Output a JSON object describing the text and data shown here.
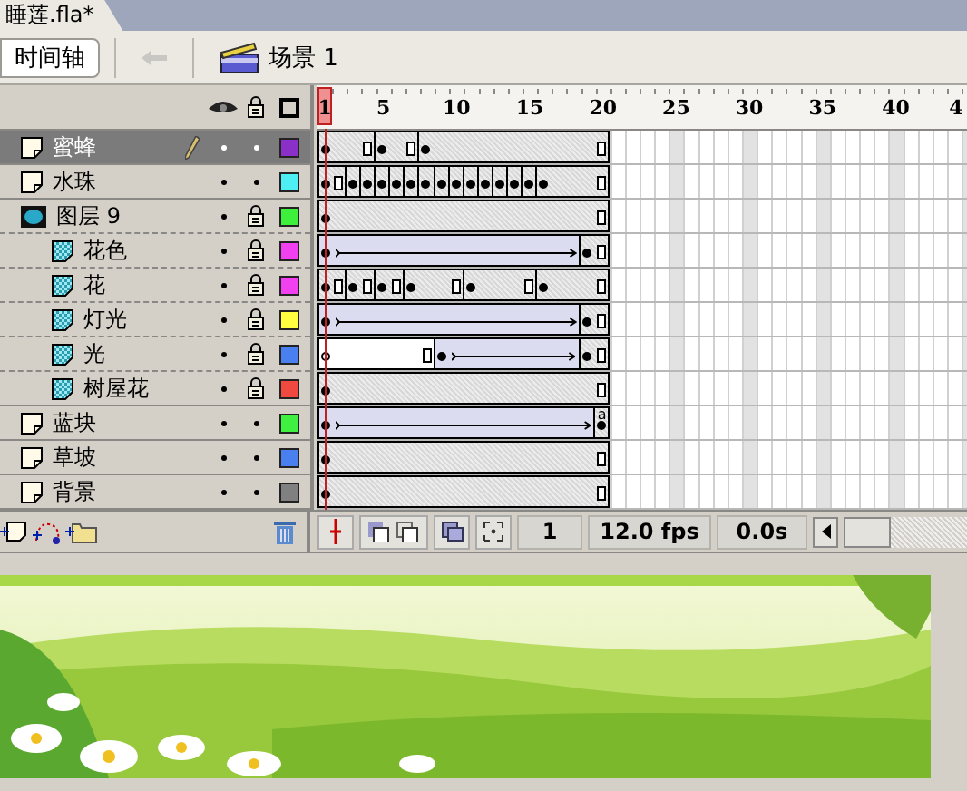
{
  "document_tab": {
    "title": "睡莲.fla*"
  },
  "toolbar": {
    "timeline_button": "时间轴",
    "back_disabled": true,
    "scene": "场景 1"
  },
  "ruler": {
    "labels": [
      {
        "text": "1",
        "current": true
      },
      {
        "text": "5",
        "current": false
      },
      {
        "text": "10",
        "current": false
      },
      {
        "text": "15",
        "current": false
      },
      {
        "text": "20",
        "current": false
      },
      {
        "text": "25",
        "current": false
      },
      {
        "text": "30",
        "current": false
      },
      {
        "text": "35",
        "current": false
      },
      {
        "text": "40",
        "current": false
      },
      {
        "text": "4",
        "current": false
      }
    ]
  },
  "layers": [
    {
      "name": "蜜蜂",
      "kind": "normal",
      "selected": true,
      "editing": true,
      "locked": false,
      "color": "#8b2fc9",
      "cells": [
        {
          "kind": "key"
        },
        {
          "kind": "frame"
        },
        {
          "kind": "frame"
        },
        {
          "kind": "end"
        },
        {
          "kind": "key"
        },
        {
          "kind": "frame"
        },
        {
          "kind": "end"
        },
        {
          "kind": "key"
        },
        {
          "kind": "frame"
        },
        {
          "kind": "frame"
        },
        {
          "kind": "frame"
        },
        {
          "kind": "frame"
        },
        {
          "kind": "frame"
        },
        {
          "kind": "frame"
        },
        {
          "kind": "frame"
        },
        {
          "kind": "frame"
        },
        {
          "kind": "frame"
        },
        {
          "kind": "frame"
        },
        {
          "kind": "frame"
        },
        {
          "kind": "end"
        }
      ]
    },
    {
      "name": "水珠",
      "kind": "normal",
      "selected": false,
      "editing": false,
      "locked": false,
      "color": "#4deef4",
      "cells": [
        {
          "kind": "key"
        },
        {
          "kind": "end"
        },
        {
          "kind": "key"
        },
        {
          "kind": "key"
        },
        {
          "kind": "key"
        },
        {
          "kind": "key"
        },
        {
          "kind": "key"
        },
        {
          "kind": "key"
        },
        {
          "kind": "key"
        },
        {
          "kind": "key"
        },
        {
          "kind": "key"
        },
        {
          "kind": "key"
        },
        {
          "kind": "key"
        },
        {
          "kind": "key"
        },
        {
          "kind": "key"
        },
        {
          "kind": "key"
        },
        {
          "kind": "frame"
        },
        {
          "kind": "frame"
        },
        {
          "kind": "frame"
        },
        {
          "kind": "end"
        }
      ]
    },
    {
      "name": "图层 9",
      "kind": "mask",
      "selected": false,
      "editing": false,
      "locked": true,
      "color": "#3cf03c",
      "cells": [
        {
          "kind": "key"
        },
        {
          "kind": "frame"
        },
        {
          "kind": "frame"
        },
        {
          "kind": "frame"
        },
        {
          "kind": "frame"
        },
        {
          "kind": "frame"
        },
        {
          "kind": "frame"
        },
        {
          "kind": "frame"
        },
        {
          "kind": "frame"
        },
        {
          "kind": "frame"
        },
        {
          "kind": "frame"
        },
        {
          "kind": "frame"
        },
        {
          "kind": "frame"
        },
        {
          "kind": "frame"
        },
        {
          "kind": "frame"
        },
        {
          "kind": "frame"
        },
        {
          "kind": "frame"
        },
        {
          "kind": "frame"
        },
        {
          "kind": "frame"
        },
        {
          "kind": "end"
        }
      ],
      "children": [
        {
          "name": "花色",
          "kind": "masked",
          "selected": false,
          "editing": false,
          "locked": true,
          "color": "#f040f0",
          "cells": [
            {
              "kind": "tween_key"
            },
            {
              "kind": "tween"
            },
            {
              "kind": "tween"
            },
            {
              "kind": "tween"
            },
            {
              "kind": "tween"
            },
            {
              "kind": "tween"
            },
            {
              "kind": "tween"
            },
            {
              "kind": "tween"
            },
            {
              "kind": "tween"
            },
            {
              "kind": "tween"
            },
            {
              "kind": "tween"
            },
            {
              "kind": "tween"
            },
            {
              "kind": "tween"
            },
            {
              "kind": "tween"
            },
            {
              "kind": "tween"
            },
            {
              "kind": "tween"
            },
            {
              "kind": "tween"
            },
            {
              "kind": "tween"
            },
            {
              "kind": "key"
            },
            {
              "kind": "end"
            }
          ]
        },
        {
          "name": "花",
          "kind": "masked",
          "selected": false,
          "editing": false,
          "locked": true,
          "color": "#f040f0",
          "cells": [
            {
              "kind": "key"
            },
            {
              "kind": "end"
            },
            {
              "kind": "key"
            },
            {
              "kind": "end"
            },
            {
              "kind": "key"
            },
            {
              "kind": "end"
            },
            {
              "kind": "key"
            },
            {
              "kind": "frame"
            },
            {
              "kind": "frame"
            },
            {
              "kind": "end"
            },
            {
              "kind": "key"
            },
            {
              "kind": "frame"
            },
            {
              "kind": "frame"
            },
            {
              "kind": "frame"
            },
            {
              "kind": "end"
            },
            {
              "kind": "key"
            },
            {
              "kind": "frame"
            },
            {
              "kind": "frame"
            },
            {
              "kind": "frame"
            },
            {
              "kind": "end"
            }
          ]
        },
        {
          "name": "灯光",
          "kind": "masked",
          "selected": false,
          "editing": false,
          "locked": true,
          "color": "#ffff40",
          "cells": [
            {
              "kind": "tween_key"
            },
            {
              "kind": "tween"
            },
            {
              "kind": "tween"
            },
            {
              "kind": "tween"
            },
            {
              "kind": "tween"
            },
            {
              "kind": "tween"
            },
            {
              "kind": "tween"
            },
            {
              "kind": "tween"
            },
            {
              "kind": "tween"
            },
            {
              "kind": "tween"
            },
            {
              "kind": "tween"
            },
            {
              "kind": "tween"
            },
            {
              "kind": "tween"
            },
            {
              "kind": "tween"
            },
            {
              "kind": "tween"
            },
            {
              "kind": "tween"
            },
            {
              "kind": "tween"
            },
            {
              "kind": "tween"
            },
            {
              "kind": "key"
            },
            {
              "kind": "end"
            }
          ]
        },
        {
          "name": "光",
          "kind": "masked",
          "selected": false,
          "editing": false,
          "locked": true,
          "color": "#4a7ff0",
          "cells": [
            {
              "kind": "blank_key"
            },
            {
              "kind": "frame"
            },
            {
              "kind": "frame"
            },
            {
              "kind": "frame"
            },
            {
              "kind": "frame"
            },
            {
              "kind": "frame"
            },
            {
              "kind": "frame"
            },
            {
              "kind": "end"
            },
            {
              "kind": "tween_key"
            },
            {
              "kind": "tween"
            },
            {
              "kind": "tween"
            },
            {
              "kind": "tween"
            },
            {
              "kind": "tween"
            },
            {
              "kind": "tween"
            },
            {
              "kind": "tween"
            },
            {
              "kind": "tween"
            },
            {
              "kind": "tween"
            },
            {
              "kind": "tween"
            },
            {
              "kind": "key"
            },
            {
              "kind": "end"
            }
          ]
        },
        {
          "name": "树屋花",
          "kind": "masked",
          "selected": false,
          "editing": false,
          "locked": true,
          "color": "#f04a40",
          "cells": [
            {
              "kind": "key"
            },
            {
              "kind": "frame"
            },
            {
              "kind": "frame"
            },
            {
              "kind": "frame"
            },
            {
              "kind": "frame"
            },
            {
              "kind": "frame"
            },
            {
              "kind": "frame"
            },
            {
              "kind": "frame"
            },
            {
              "kind": "frame"
            },
            {
              "kind": "frame"
            },
            {
              "kind": "frame"
            },
            {
              "kind": "frame"
            },
            {
              "kind": "frame"
            },
            {
              "kind": "frame"
            },
            {
              "kind": "frame"
            },
            {
              "kind": "frame"
            },
            {
              "kind": "frame"
            },
            {
              "kind": "frame"
            },
            {
              "kind": "frame"
            },
            {
              "kind": "end"
            }
          ]
        }
      ]
    },
    {
      "name": "蓝块",
      "kind": "normal",
      "selected": false,
      "editing": false,
      "locked": false,
      "color": "#40f040",
      "cells": [
        {
          "kind": "tween_key"
        },
        {
          "kind": "tween"
        },
        {
          "kind": "tween"
        },
        {
          "kind": "tween"
        },
        {
          "kind": "tween"
        },
        {
          "kind": "tween"
        },
        {
          "kind": "tween"
        },
        {
          "kind": "tween"
        },
        {
          "kind": "tween"
        },
        {
          "kind": "tween"
        },
        {
          "kind": "tween"
        },
        {
          "kind": "tween"
        },
        {
          "kind": "tween"
        },
        {
          "kind": "tween"
        },
        {
          "kind": "tween"
        },
        {
          "kind": "tween"
        },
        {
          "kind": "tween"
        },
        {
          "kind": "tween"
        },
        {
          "kind": "tween"
        },
        {
          "kind": "action_key",
          "label": "a"
        }
      ]
    },
    {
      "name": "草坡",
      "kind": "normal",
      "selected": false,
      "editing": false,
      "locked": false,
      "color": "#4a7ff0",
      "cells": [
        {
          "kind": "key"
        },
        {
          "kind": "frame"
        },
        {
          "kind": "frame"
        },
        {
          "kind": "frame"
        },
        {
          "kind": "frame"
        },
        {
          "kind": "frame"
        },
        {
          "kind": "frame"
        },
        {
          "kind": "frame"
        },
        {
          "kind": "frame"
        },
        {
          "kind": "frame"
        },
        {
          "kind": "frame"
        },
        {
          "kind": "frame"
        },
        {
          "kind": "frame"
        },
        {
          "kind": "frame"
        },
        {
          "kind": "frame"
        },
        {
          "kind": "frame"
        },
        {
          "kind": "frame"
        },
        {
          "kind": "frame"
        },
        {
          "kind": "frame"
        },
        {
          "kind": "end"
        }
      ]
    },
    {
      "name": "背景",
      "kind": "normal",
      "selected": false,
      "editing": false,
      "locked": false,
      "color": "#808080",
      "cells": [
        {
          "kind": "key"
        },
        {
          "kind": "frame"
        },
        {
          "kind": "frame"
        },
        {
          "kind": "frame"
        },
        {
          "kind": "frame"
        },
        {
          "kind": "frame"
        },
        {
          "kind": "frame"
        },
        {
          "kind": "frame"
        },
        {
          "kind": "frame"
        },
        {
          "kind": "frame"
        },
        {
          "kind": "frame"
        },
        {
          "kind": "frame"
        },
        {
          "kind": "frame"
        },
        {
          "kind": "frame"
        },
        {
          "kind": "frame"
        },
        {
          "kind": "frame"
        },
        {
          "kind": "frame"
        },
        {
          "kind": "frame"
        },
        {
          "kind": "frame"
        },
        {
          "kind": "end"
        }
      ]
    }
  ],
  "footer": {
    "frame": "1",
    "fps": "12.0 fps",
    "time": "0.0s"
  }
}
